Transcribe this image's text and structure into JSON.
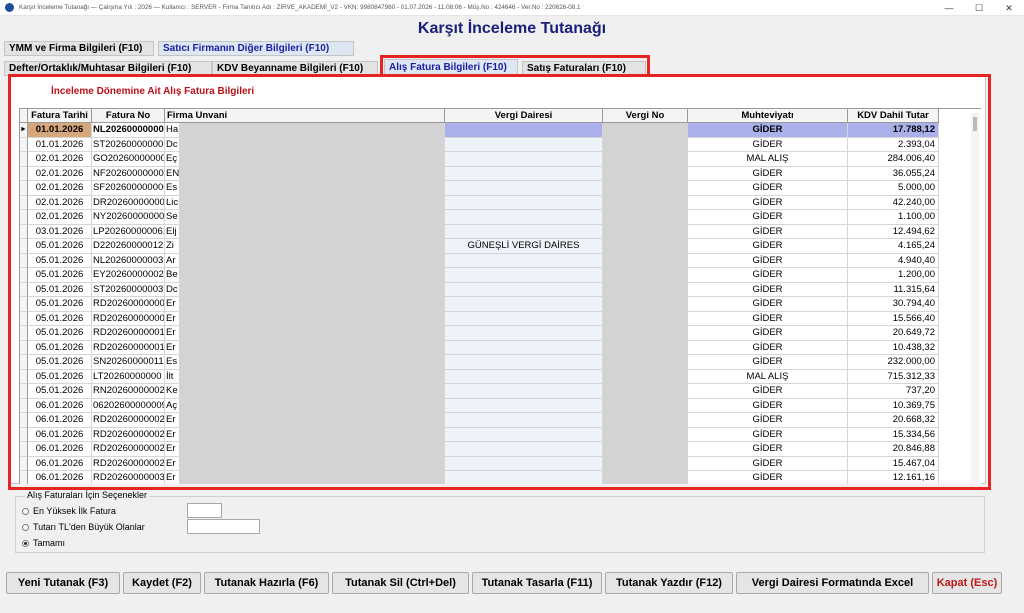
{
  "window": {
    "title_text": "Karşıt İnceleme Tutanağı — Çalışma Yılı : 2026 — Kullanıcı : SERVER - Firma Tanıtıcı Adı : ZİRVE_AKADEMİ_V2 - VKN: 9980847980 - 01.07.2026 - 11:08:06 - Müş.No : 424646 - Ver.No : 220626-08.1",
    "minimize": "—",
    "maximize": "☐",
    "close": "✕"
  },
  "header": {
    "title": "Karşıt İnceleme Tutanağı"
  },
  "tabs_row1": [
    {
      "label": "YMM ve Firma Bilgileri (F10)"
    },
    {
      "label": "Satıcı Firmanın Diğer Bilgileri (F10)"
    }
  ],
  "tabs_row2": [
    {
      "label": "Defter/Ortaklık/Muhtasar Bilgileri (F10)"
    },
    {
      "label": "KDV Beyanname Bilgileri (F10)"
    },
    {
      "label": "Alış Fatura Bilgileri (F10)"
    },
    {
      "label": "Satış Faturaları (F10)"
    }
  ],
  "panel": {
    "title": "İnceleme Dönemine Ait Alış Fatura Bilgileri"
  },
  "grid": {
    "row_marker": "►",
    "columns": [
      "Fatura Tarihi",
      "Fatura No",
      "Firma Unvani",
      "Vergi Dairesi",
      "Vergi No",
      "Muhteviyatı",
      "KDV Dahil Tutar"
    ],
    "rows": [
      {
        "date": "01.01.2026",
        "no": "NL20260000000",
        "firm": "Ha",
        "vd": "",
        "vno": "",
        "muh": "GİDER",
        "amt": "17.788,12"
      },
      {
        "date": "01.01.2026",
        "no": "ST20260000000E",
        "firm": "Dc",
        "vd": "",
        "vno": "",
        "muh": "GİDER",
        "amt": "2.393,04"
      },
      {
        "date": "02.01.2026",
        "no": "GO20260000000",
        "firm": "Eç",
        "vd": "",
        "vno": "",
        "muh": "MAL ALIŞ",
        "amt": "284.006,40"
      },
      {
        "date": "02.01.2026",
        "no": "NF20260000000C",
        "firm": "EN",
        "vd": "",
        "vno": "",
        "muh": "GİDER",
        "amt": "36.055,24"
      },
      {
        "date": "02.01.2026",
        "no": "SF202600000006",
        "firm": "Es",
        "vd": "",
        "vno": "",
        "muh": "GİDER",
        "amt": "5.000,00"
      },
      {
        "date": "02.01.2026",
        "no": "DR20260000000",
        "firm": "Lic",
        "vd": "",
        "vno": "",
        "muh": "GİDER",
        "amt": "42.240,00"
      },
      {
        "date": "02.01.2026",
        "no": "NY20260000000",
        "firm": "Se",
        "vd": "",
        "vno": "",
        "muh": "GİDER",
        "amt": "1.100,00"
      },
      {
        "date": "03.01.2026",
        "no": "LP202600000061",
        "firm": "Elj",
        "vd": "",
        "vno": "",
        "muh": "GİDER",
        "amt": "12.494,62"
      },
      {
        "date": "05.01.2026",
        "no": "D220260000012E",
        "firm": "Zi",
        "vd": "GÜNEŞLİ VERGİ DAİRES",
        "vno": "",
        "muh": "GİDER",
        "amt": "4.165,24"
      },
      {
        "date": "05.01.2026",
        "no": "NL20260000003",
        "firm": "Ar",
        "vd": "",
        "vno": "",
        "muh": "GİDER",
        "amt": "4.940,40"
      },
      {
        "date": "05.01.2026",
        "no": "EY20260000002C",
        "firm": "Be",
        "vd": "",
        "vno": "",
        "muh": "GİDER",
        "amt": "1.200,00"
      },
      {
        "date": "05.01.2026",
        "no": "ST202600000037",
        "firm": "Dc",
        "vd": "",
        "vno": "",
        "muh": "GİDER",
        "amt": "11.315,64"
      },
      {
        "date": "05.01.2026",
        "no": "RD20260000000C",
        "firm": "Er",
        "vd": "",
        "vno": "",
        "muh": "GİDER",
        "amt": "30.794,40"
      },
      {
        "date": "05.01.2026",
        "no": "RD20260000000",
        "firm": "Er",
        "vd": "",
        "vno": "",
        "muh": "GİDER",
        "amt": "15.566,40"
      },
      {
        "date": "05.01.2026",
        "no": "RD20260000001",
        "firm": "Er",
        "vd": "",
        "vno": "",
        "muh": "GİDER",
        "amt": "20.649,72"
      },
      {
        "date": "05.01.2026",
        "no": "RD20260000001",
        "firm": "Er",
        "vd": "",
        "vno": "",
        "muh": "GİDER",
        "amt": "10.438,32"
      },
      {
        "date": "05.01.2026",
        "no": "SN20260000011S",
        "firm": "Es",
        "vd": "",
        "vno": "",
        "muh": "GİDER",
        "amt": "232.000,00"
      },
      {
        "date": "05.01.2026",
        "no": "LT20260000000",
        "firm": "İlt",
        "vd": "",
        "vno": "",
        "muh": "MAL ALIŞ",
        "amt": "715.312,33"
      },
      {
        "date": "05.01.2026",
        "no": "RN20260000002S",
        "firm": "Ke",
        "vd": "",
        "vno": "",
        "muh": "GİDER",
        "amt": "737,20"
      },
      {
        "date": "06.01.2026",
        "no": "062026000000097",
        "firm": "Aç",
        "vd": "",
        "vno": "",
        "muh": "GİDER",
        "amt": "10.369,75"
      },
      {
        "date": "06.01.2026",
        "no": "RD20260000002",
        "firm": "Er",
        "vd": "",
        "vno": "",
        "muh": "GİDER",
        "amt": "20.668,32"
      },
      {
        "date": "06.01.2026",
        "no": "RD20260000002",
        "firm": "Er",
        "vd": "",
        "vno": "",
        "muh": "GİDER",
        "amt": "15.334,56"
      },
      {
        "date": "06.01.2026",
        "no": "RD20260000002",
        "firm": "Er",
        "vd": "",
        "vno": "",
        "muh": "GİDER",
        "amt": "20.846,88"
      },
      {
        "date": "06.01.2026",
        "no": "RD20260000002",
        "firm": "Er",
        "vd": "",
        "vno": "",
        "muh": "GİDER",
        "amt": "15.467,04"
      },
      {
        "date": "06.01.2026",
        "no": "RD20260000003",
        "firm": "Er",
        "vd": "",
        "vno": "",
        "muh": "GİDER",
        "amt": "12.161,16"
      }
    ]
  },
  "options": {
    "legend": "Alış Faturaları İçin Seçenekler",
    "items": [
      {
        "label": "En Yüksek İlk Fatura",
        "selected": false
      },
      {
        "label": "Tutarı TL'den Büyük Olanlar",
        "selected": false
      },
      {
        "label": "Tamamı",
        "selected": true
      }
    ],
    "input1_value": "",
    "input2_value": ""
  },
  "buttons": [
    {
      "label": "Yeni Tutanak (F3)"
    },
    {
      "label": "Kaydet (F2)"
    },
    {
      "label": "Tutanak Hazırla (F6)"
    },
    {
      "label": "Tutanak Sil (Ctrl+Del)"
    },
    {
      "label": "Tutanak Tasarla (F11)"
    },
    {
      "label": "Tutanak Yazdır (F12)"
    },
    {
      "label": "Vergi Dairesi Formatında Excel"
    },
    {
      "label": "Kapat (Esc)"
    }
  ],
  "colors": {
    "title_blue": "#1a1f7a",
    "panel_title_red": "#b8111a",
    "highlight_red": "#e62424",
    "close_red": "#c01818",
    "selected_date": "#d6a77d",
    "selected_blue": "#aab0ea",
    "redacted_gray": "#d3d3d3"
  },
  "icons": {
    "app": "app-icon",
    "row_pointer": "row-pointer-icon"
  }
}
